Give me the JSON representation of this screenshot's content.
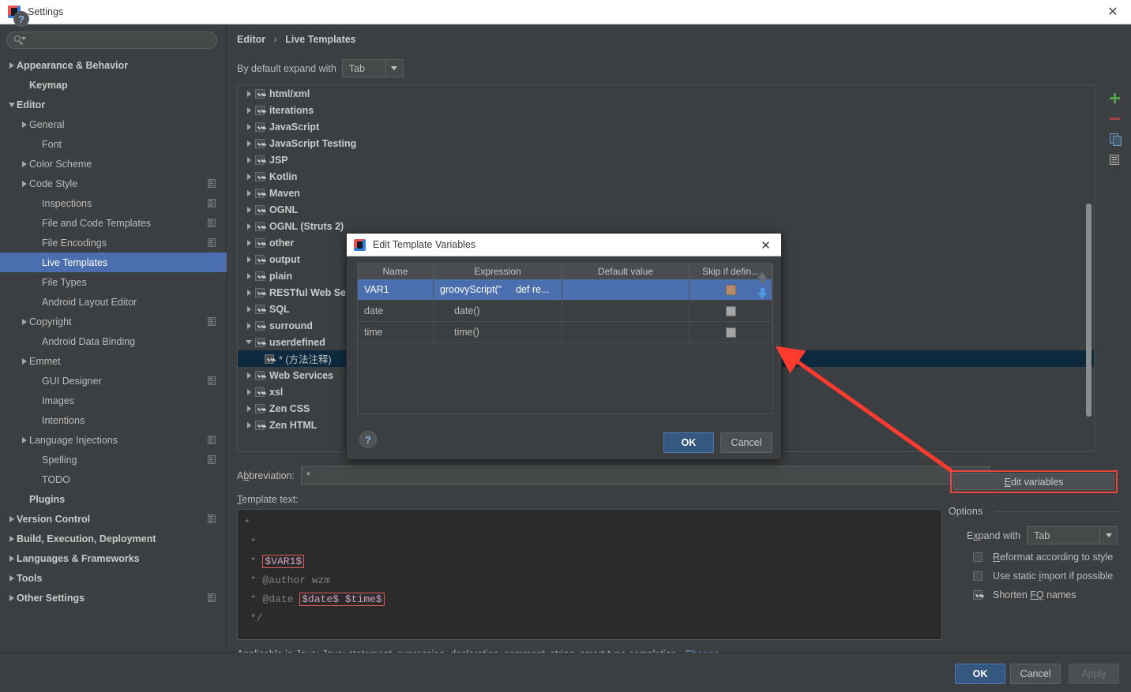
{
  "window": {
    "title": "Settings",
    "close_label": "✕",
    "app_icon": "intellij-logo-icon"
  },
  "sidebar": {
    "search": {
      "placeholder": "",
      "value": "",
      "icon": "search-icon"
    },
    "items": [
      {
        "label": "Appearance & Behavior",
        "arrow": "right",
        "indent": 0,
        "bold": true,
        "selected": false,
        "badge": false
      },
      {
        "label": "Keymap",
        "arrow": "none",
        "indent": 1,
        "bold": true,
        "selected": false,
        "badge": false
      },
      {
        "label": "Editor",
        "arrow": "down",
        "indent": 0,
        "bold": true,
        "selected": false,
        "badge": false
      },
      {
        "label": "General",
        "arrow": "right",
        "indent": 1,
        "bold": false,
        "selected": false,
        "badge": false
      },
      {
        "label": "Font",
        "arrow": "none",
        "indent": 2,
        "bold": false,
        "selected": false,
        "badge": false
      },
      {
        "label": "Color Scheme",
        "arrow": "right",
        "indent": 1,
        "bold": false,
        "selected": false,
        "badge": false
      },
      {
        "label": "Code Style",
        "arrow": "right",
        "indent": 1,
        "bold": false,
        "selected": false,
        "badge": true
      },
      {
        "label": "Inspections",
        "arrow": "none",
        "indent": 2,
        "bold": false,
        "selected": false,
        "badge": true
      },
      {
        "label": "File and Code Templates",
        "arrow": "none",
        "indent": 2,
        "bold": false,
        "selected": false,
        "badge": true
      },
      {
        "label": "File Encodings",
        "arrow": "none",
        "indent": 2,
        "bold": false,
        "selected": false,
        "badge": true
      },
      {
        "label": "Live Templates",
        "arrow": "none",
        "indent": 2,
        "bold": false,
        "selected": true,
        "badge": false
      },
      {
        "label": "File Types",
        "arrow": "none",
        "indent": 2,
        "bold": false,
        "selected": false,
        "badge": false
      },
      {
        "label": "Android Layout Editor",
        "arrow": "none",
        "indent": 2,
        "bold": false,
        "selected": false,
        "badge": false
      },
      {
        "label": "Copyright",
        "arrow": "right",
        "indent": 1,
        "bold": false,
        "selected": false,
        "badge": true
      },
      {
        "label": "Android Data Binding",
        "arrow": "none",
        "indent": 2,
        "bold": false,
        "selected": false,
        "badge": false
      },
      {
        "label": "Emmet",
        "arrow": "right",
        "indent": 1,
        "bold": false,
        "selected": false,
        "badge": false
      },
      {
        "label": "GUI Designer",
        "arrow": "none",
        "indent": 2,
        "bold": false,
        "selected": false,
        "badge": true
      },
      {
        "label": "Images",
        "arrow": "none",
        "indent": 2,
        "bold": false,
        "selected": false,
        "badge": false
      },
      {
        "label": "Intentions",
        "arrow": "none",
        "indent": 2,
        "bold": false,
        "selected": false,
        "badge": false
      },
      {
        "label": "Language Injections",
        "arrow": "right",
        "indent": 1,
        "bold": false,
        "selected": false,
        "badge": true
      },
      {
        "label": "Spelling",
        "arrow": "none",
        "indent": 2,
        "bold": false,
        "selected": false,
        "badge": true
      },
      {
        "label": "TODO",
        "arrow": "none",
        "indent": 2,
        "bold": false,
        "selected": false,
        "badge": false
      },
      {
        "label": "Plugins",
        "arrow": "none",
        "indent": 1,
        "bold": true,
        "selected": false,
        "badge": false
      },
      {
        "label": "Version Control",
        "arrow": "right",
        "indent": 0,
        "bold": true,
        "selected": false,
        "badge": true
      },
      {
        "label": "Build, Execution, Deployment",
        "arrow": "right",
        "indent": 0,
        "bold": true,
        "selected": false,
        "badge": false
      },
      {
        "label": "Languages & Frameworks",
        "arrow": "right",
        "indent": 0,
        "bold": true,
        "selected": false,
        "badge": false
      },
      {
        "label": "Tools",
        "arrow": "right",
        "indent": 0,
        "bold": true,
        "selected": false,
        "badge": false
      },
      {
        "label": "Other Settings",
        "arrow": "right",
        "indent": 0,
        "bold": true,
        "selected": false,
        "badge": true
      }
    ]
  },
  "main": {
    "breadcrumb": {
      "parent": "Editor",
      "separator": "›",
      "current": "Live Templates"
    },
    "expand_with": {
      "label": "By default expand with",
      "value": "Tab"
    },
    "template_tree": [
      {
        "label": "html/xml",
        "arrow": "right",
        "checked": true,
        "child": false,
        "selected": false
      },
      {
        "label": "iterations",
        "arrow": "right",
        "checked": true,
        "child": false,
        "selected": false
      },
      {
        "label": "JavaScript",
        "arrow": "right",
        "checked": true,
        "child": false,
        "selected": false
      },
      {
        "label": "JavaScript Testing",
        "arrow": "right",
        "checked": true,
        "child": false,
        "selected": false
      },
      {
        "label": "JSP",
        "arrow": "right",
        "checked": true,
        "child": false,
        "selected": false
      },
      {
        "label": "Kotlin",
        "arrow": "right",
        "checked": true,
        "child": false,
        "selected": false
      },
      {
        "label": "Maven",
        "arrow": "right",
        "checked": true,
        "child": false,
        "selected": false
      },
      {
        "label": "OGNL",
        "arrow": "right",
        "checked": true,
        "child": false,
        "selected": false
      },
      {
        "label": "OGNL (Struts 2)",
        "arrow": "right",
        "checked": true,
        "child": false,
        "selected": false
      },
      {
        "label": "other",
        "arrow": "right",
        "checked": true,
        "child": false,
        "selected": false
      },
      {
        "label": "output",
        "arrow": "right",
        "checked": true,
        "child": false,
        "selected": false
      },
      {
        "label": "plain",
        "arrow": "right",
        "checked": true,
        "child": false,
        "selected": false
      },
      {
        "label": "RESTful Web Services",
        "arrow": "right",
        "checked": true,
        "child": false,
        "selected": false
      },
      {
        "label": "SQL",
        "arrow": "right",
        "checked": true,
        "child": false,
        "selected": false
      },
      {
        "label": "surround",
        "arrow": "right",
        "checked": true,
        "child": false,
        "selected": false
      },
      {
        "label": "userdefined",
        "arrow": "down",
        "checked": true,
        "child": false,
        "selected": false
      },
      {
        "label": "* (方法注释)",
        "arrow": "none",
        "checked": true,
        "child": true,
        "selected": true
      },
      {
        "label": "Web Services",
        "arrow": "right",
        "checked": true,
        "child": false,
        "selected": false
      },
      {
        "label": "xsl",
        "arrow": "right",
        "checked": true,
        "child": false,
        "selected": false
      },
      {
        "label": "Zen CSS",
        "arrow": "right",
        "checked": true,
        "child": false,
        "selected": false
      },
      {
        "label": "Zen HTML",
        "arrow": "right",
        "checked": true,
        "child": false,
        "selected": false
      }
    ],
    "toolbar": [
      {
        "icon": "add-icon",
        "name": "add-template-button"
      },
      {
        "icon": "remove-icon",
        "name": "remove-template-button"
      },
      {
        "icon": "duplicate-icon",
        "name": "duplicate-template-button"
      },
      {
        "icon": "document-icon",
        "name": "template-group-button"
      }
    ],
    "abbreviation": {
      "label_prefix": "A",
      "label_underlined": "b",
      "label_suffix": "breviation:",
      "value": "*"
    },
    "template_text": {
      "label_prefix": "",
      "label_underlined": "T",
      "label_suffix": "emplate text:",
      "lines": [
        {
          "prefix": "*",
          "var": "",
          "suffix": ""
        },
        {
          "prefix": " *",
          "var": "",
          "suffix": ""
        },
        {
          "prefix": " * ",
          "var": "$VAR1$",
          "suffix": ""
        },
        {
          "prefix": " * @author wzm",
          "var": "",
          "suffix": ""
        },
        {
          "prefix": " * @date ",
          "var": "$date$ $time$",
          "suffix": ""
        },
        {
          "prefix": " */",
          "var": "",
          "suffix": ""
        }
      ]
    },
    "status": {
      "text": "Applicable in Java; Java: statement, expression, declaration, comment, string, smart type completion...",
      "link": "Change"
    },
    "edit_variables_button": {
      "prefix": "",
      "underlined": "E",
      "suffix": "dit variables"
    },
    "options": {
      "title": "Options",
      "expand_with": {
        "prefix": "E",
        "underlined": "x",
        "suffix": "pand with",
        "value": "Tab"
      },
      "checkboxes": [
        {
          "prefix": "",
          "underlined": "R",
          "suffix": "eformat according to style",
          "checked": false
        },
        {
          "prefix": "Use static ",
          "underlined": "i",
          "suffix": "mport if possible",
          "checked": false
        },
        {
          "prefix": "Shorten ",
          "underlined": "FQ",
          "suffix": " names",
          "checked": true
        }
      ]
    }
  },
  "dialog": {
    "title": "Edit Template Variables",
    "close_label": "✕",
    "columns": [
      "Name",
      "Expression",
      "Default value",
      "Skip if defin..."
    ],
    "rows": [
      {
        "name": "VAR1",
        "expr_left": "groovyScript(\"",
        "expr_right": "def re...",
        "default": "",
        "skip": false,
        "selected": true
      },
      {
        "name": "date",
        "expr_left": "date()",
        "expr_right": "",
        "default": "",
        "skip": false,
        "selected": false
      },
      {
        "name": "time",
        "expr_left": "time()",
        "expr_right": "",
        "default": "",
        "skip": false,
        "selected": false
      }
    ],
    "move_up": "move-up-icon",
    "move_down": "move-down-icon",
    "help_label": "?",
    "ok_label": "OK",
    "cancel_label": "Cancel"
  },
  "footer": {
    "help_label": "?",
    "ok_label": "OK",
    "cancel_label": "Cancel",
    "apply_label": "Apply"
  },
  "colors": {
    "accent_selection": "#4b6eaf",
    "tree_selection": "#0d293e",
    "annotation_red": "#e8453c",
    "link_blue": "#6ca0d8",
    "primary_button": "#365880"
  }
}
